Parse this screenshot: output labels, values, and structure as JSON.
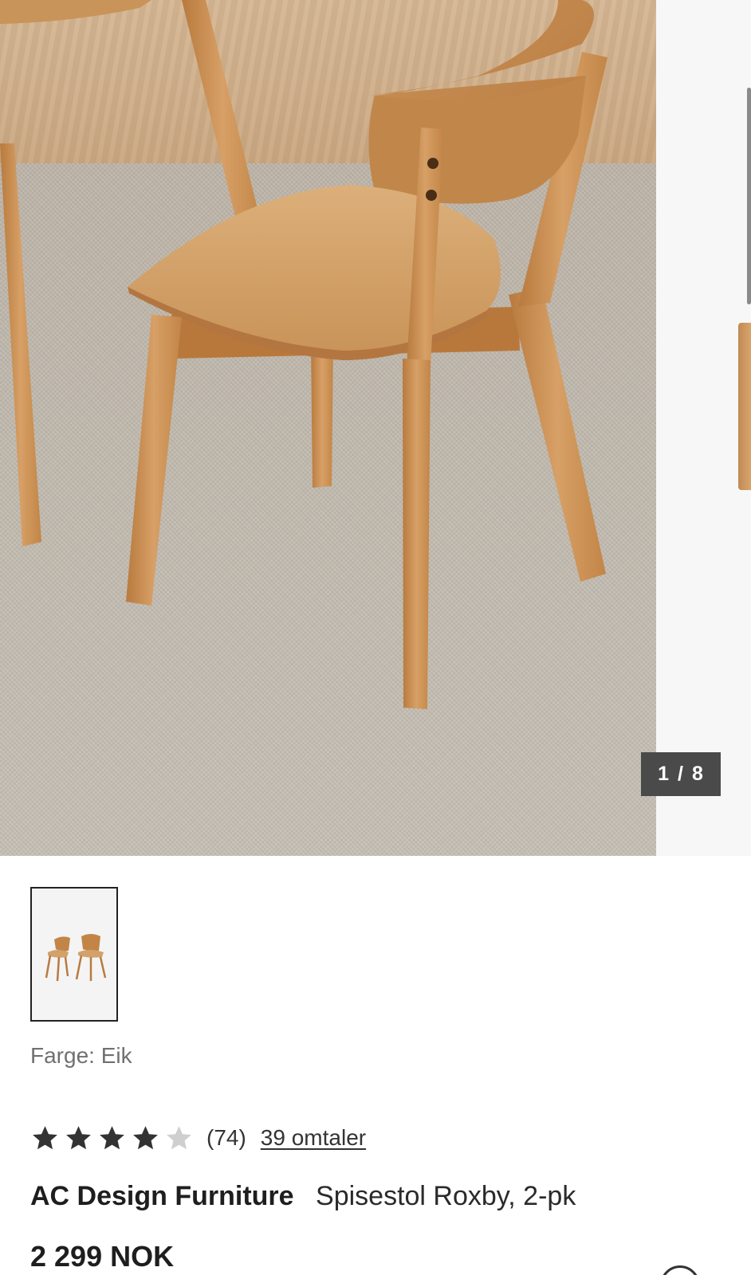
{
  "gallery": {
    "counter_current": "1",
    "counter_separator": "/",
    "counter_total": "8"
  },
  "product": {
    "color_label": "Farge: Eik",
    "rating": {
      "stars_filled": 4,
      "stars_total": 5,
      "count_text": "(74)",
      "reviews_link": "39 omtaler"
    },
    "brand": "AC Design Furniture",
    "name": "Spisestol Roxby, 2-pk",
    "price": "2 299 NOK"
  },
  "colors": {
    "star_filled": "#333333",
    "star_empty": "#cfcfcf",
    "counter_bg": "#4a4a4a",
    "wood": "#c8914f"
  },
  "icons": {
    "star": "star-icon",
    "thumbnail": "chair-pair-thumbnail"
  }
}
